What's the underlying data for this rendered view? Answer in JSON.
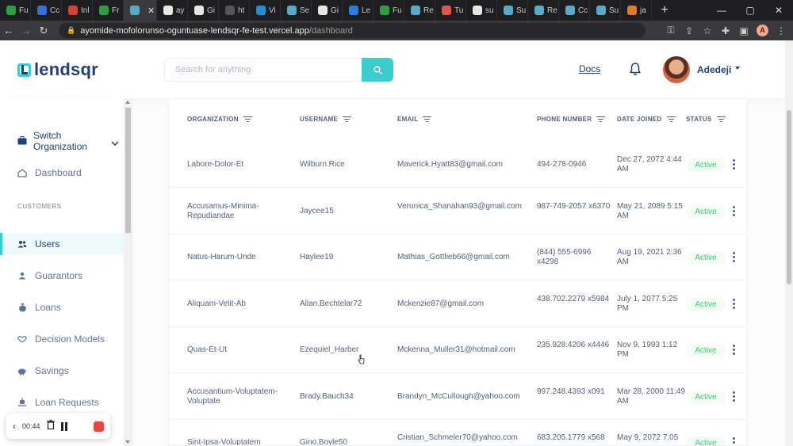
{
  "browser": {
    "tabs": [
      {
        "label": "Fu",
        "color": "#2e9e45"
      },
      {
        "label": "Cc",
        "color": "#3b6fd6"
      },
      {
        "label": "Inl",
        "color": "#d64035"
      },
      {
        "label": "Fr",
        "color": "#2e9e45"
      },
      {
        "label": "",
        "color": "#5aa9c9",
        "active": true
      },
      {
        "label": "ay",
        "color": "#e6e6e6"
      },
      {
        "label": "Gi",
        "color": "#e6e6e6"
      },
      {
        "label": "ht",
        "color": "#555555"
      },
      {
        "label": "Vi",
        "color": "#1f8fd8"
      },
      {
        "label": "Se",
        "color": "#5aa9c9"
      },
      {
        "label": "Gi",
        "color": "#e6e6e6"
      },
      {
        "label": "Le",
        "color": "#2b7de0"
      },
      {
        "label": "Fu",
        "color": "#2e9e45"
      },
      {
        "label": "Re",
        "color": "#5aa9c9"
      },
      {
        "label": "Tu",
        "color": "#e0574a"
      },
      {
        "label": "su",
        "color": "#e6e6e6"
      },
      {
        "label": "Su",
        "color": "#5aa9c9"
      },
      {
        "label": "Re",
        "color": "#5aa9c9"
      },
      {
        "label": "Cc",
        "color": "#5aa9c9"
      },
      {
        "label": "Su",
        "color": "#5aa9c9"
      },
      {
        "label": "ja",
        "color": "#e07a2e"
      }
    ],
    "url_host": "ayomide-mofolorunso-oguntuase-lendsqr-fe-test.vercel.app",
    "url_path": "/dashboard",
    "profile_initial": "A"
  },
  "header": {
    "logo_text": "lendsqr",
    "search_placeholder": "Search for anything",
    "docs_label": "Docs",
    "user_name": "Adedeji"
  },
  "sidebar": {
    "switch_org_label": "Switch Organization",
    "dashboard_label": "Dashboard",
    "section_customers": "CUSTOMERS",
    "items": [
      {
        "label": "Users",
        "icon": "users-icon",
        "active": true
      },
      {
        "label": "Guarantors",
        "icon": "guarantors-icon"
      },
      {
        "label": "Loans",
        "icon": "loans-icon"
      },
      {
        "label": "Decision Models",
        "icon": "handshake-icon"
      },
      {
        "label": "Savings",
        "icon": "piggy-bank-icon"
      },
      {
        "label": "Loan Requests",
        "icon": "loan-request-icon"
      }
    ]
  },
  "recorder": {
    "time": "00:44"
  },
  "table": {
    "headers": [
      "ORGANIZATION",
      "USERNAME",
      "EMAIL",
      "PHONE NUMBER",
      "DATE JOINED",
      "STATUS"
    ],
    "rows": [
      {
        "org": "Labore-Dolor-Et",
        "username": "Wilburn.Rice",
        "email": "Maverick.Hyatt83@gmail.com",
        "phone": "494-278-0946",
        "date": "Dec 27, 2072 4:44 AM",
        "status": "Active"
      },
      {
        "org": "Accusamus-Minima-Repudiandae",
        "username": "Jaycee15",
        "email": "Veronica_Shanahan93@gmail.com",
        "phone": "987-749-2057 x6370",
        "date": "May 21, 2089 5:15 AM",
        "status": "Active"
      },
      {
        "org": "Natus-Harum-Unde",
        "username": "Haylee19",
        "email": "Mathias_Gottlieb66@gmail.com",
        "phone": "(844) 555-6996 x4298",
        "date": "Aug 19, 2021 2:36 AM",
        "status": "Active"
      },
      {
        "org": "Aliquam-Velit-Ab",
        "username": "Allan.Bechtelar72",
        "email": "Mckenzie87@gmail.com",
        "phone": "438.702.2279 x5984",
        "date": "July 1, 2077 5:25 PM",
        "status": "Active"
      },
      {
        "org": "Quas-Et-Ut",
        "username": "Ezequiel_Harber",
        "email": "Mckenna_Muller31@hotmail.com",
        "phone": "235.928.4206 x4446",
        "date": "Nov 9, 1993 1:12 PM",
        "status": "Active"
      },
      {
        "org": "Accusantium-Voluptatem-Voluptate",
        "username": "Brady.Bauch34",
        "email": "Brandyn_McCullough@yahoo.com",
        "phone": "997.248.4393 x091",
        "date": "Mar 28, 2000 11:49 AM",
        "status": "Active"
      },
      {
        "org": "Sint-Ipsa-Voluptatem",
        "username": "Gino.Boyle50",
        "email": "Cristian_Schmeler70@yahoo.com",
        "phone": "683.205.1779 x568",
        "date": "May 9, 2072 7:05",
        "status": "Active"
      }
    ]
  },
  "colors": {
    "primary": "#213f7d",
    "accent": "#39cdcc",
    "active_status": "#39cd62"
  }
}
